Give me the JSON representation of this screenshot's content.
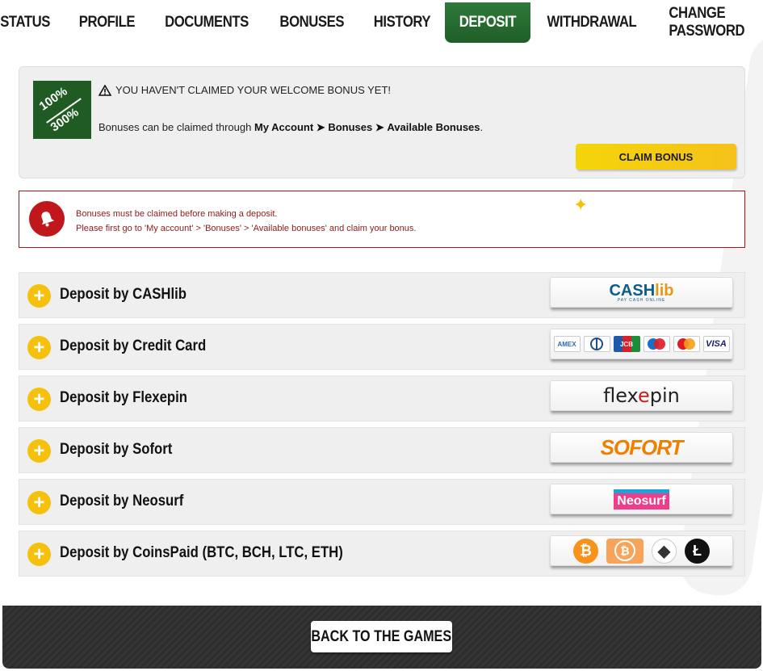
{
  "tabs": [
    {
      "label": "STATUS",
      "active": false
    },
    {
      "label": "PROFILE",
      "active": false
    },
    {
      "label": "DOCUMENTS",
      "active": false
    },
    {
      "label": "BONUSES",
      "active": false
    },
    {
      "label": "HISTORY",
      "active": false
    },
    {
      "label": "DEPOSIT",
      "active": true
    },
    {
      "label": "WITHDRAWAL",
      "active": false
    },
    {
      "label": "CHANGE PASSWORD",
      "active": false
    }
  ],
  "bonus": {
    "badge_top": "100%",
    "badge_bottom": "300%",
    "warning_icon": "warning-triangle-icon",
    "warning": "YOU HAVEN'T CLAIMED YOUR WELCOME BONUS YET!",
    "info_prefix": "Bonuses can be claimed through ",
    "path_1": "My Account",
    "arrow": "➤",
    "path_2": "Bonuses",
    "path_3": "Available Bonuses",
    "info_suffix": ".",
    "claim_label": "CLAIM BONUS"
  },
  "alert": {
    "icon": "bell-icon",
    "line1": "Bonuses must be claimed before making a deposit.",
    "line2": "Please first go to 'My account' > 'Bonuses' > 'Available bonuses' and claim your bonus."
  },
  "deposits": [
    {
      "label": "Deposit by CASHlib",
      "logo": "cashlib-logo",
      "logo_text_a": "CASH",
      "logo_text_b": "lib",
      "logo_sub": "PAY CASH ONLINE"
    },
    {
      "label": "Deposit by Credit Card",
      "logo": "credit-cards-logo",
      "cards": [
        "AMEX",
        "DC",
        "JCB",
        "Maestro",
        "MC",
        "VISA"
      ]
    },
    {
      "label": "Deposit by Flexepin",
      "logo": "flexepin-logo",
      "logo_text_a": "flex",
      "logo_text_b": "e",
      "logo_text_c": "pin"
    },
    {
      "label": "Deposit by Sofort",
      "logo": "sofort-logo",
      "logo_text_a": "SOFORT"
    },
    {
      "label": "Deposit by Neosurf",
      "logo": "neosurf-logo",
      "logo_text_a": "Neosurf"
    },
    {
      "label": "Deposit by CoinsPaid (BTC, BCH, LTC, ETH)",
      "logo": "crypto-logo",
      "coins": [
        "₿",
        "₿",
        "◆",
        "Ł"
      ]
    }
  ],
  "footer": {
    "back_label": "BACK TO THE GAMES"
  },
  "colors": {
    "active_tab": "#2f7a3a",
    "claim": "#f4d40a",
    "alert_border": "#9b1b1b",
    "plus": "#f4c20d",
    "footer": "#2d2d2d"
  }
}
